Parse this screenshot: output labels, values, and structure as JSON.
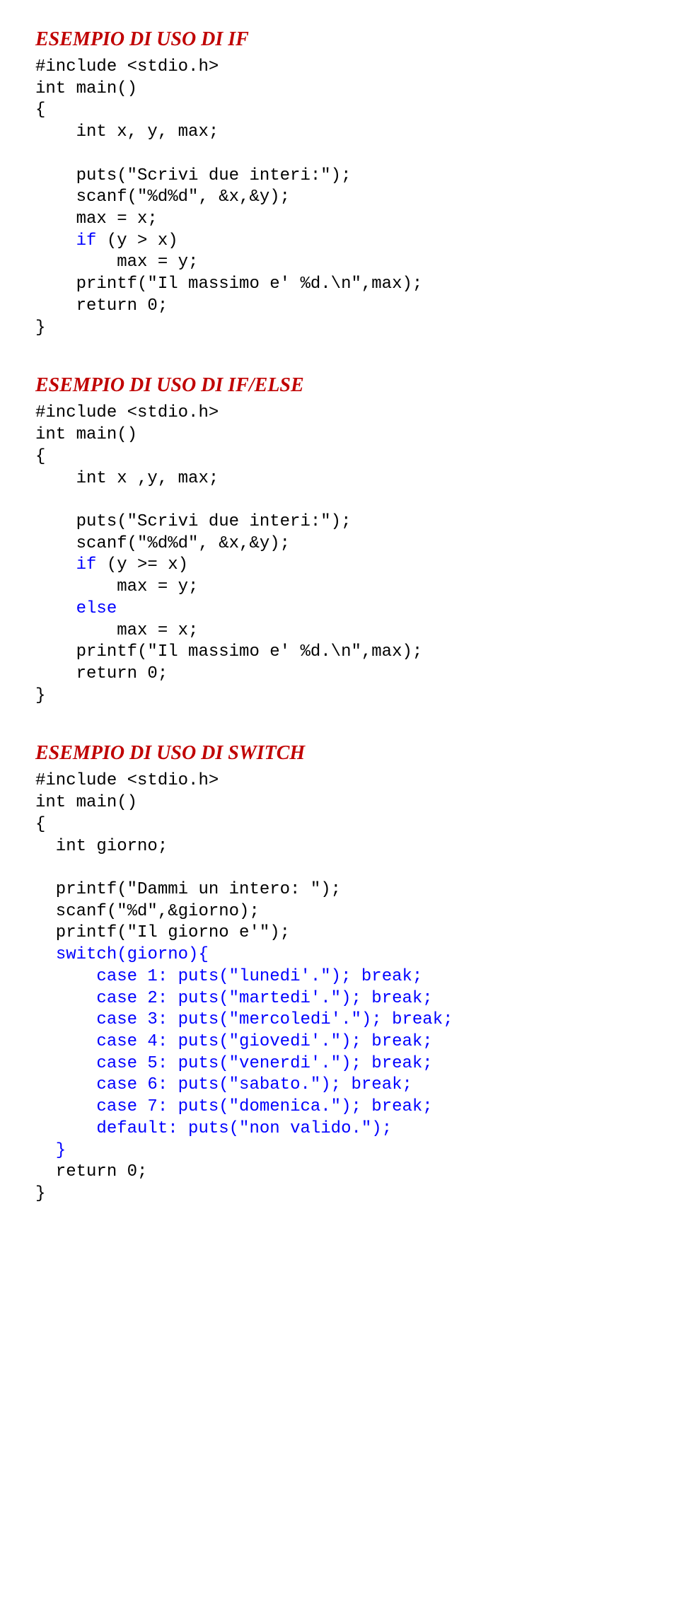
{
  "sections": [
    {
      "heading": "ESEMPIO DI USO DI IF",
      "code": [
        {
          "t": "#include <stdio.h>",
          "c": "blk"
        },
        {
          "t": "int main()",
          "c": "blk"
        },
        {
          "t": "{",
          "c": "blk"
        },
        {
          "t": "    int x, y, max;",
          "c": "blk"
        },
        {
          "t": "",
          "c": "blk"
        },
        {
          "t": "    puts(\"Scrivi due interi:\");",
          "c": "blk"
        },
        {
          "t": "    scanf(\"%d%d\", &x,&y);",
          "c": "blk"
        },
        {
          "t": "    max = x;",
          "c": "blk"
        },
        [
          {
            "t": "    ",
            "c": "blk"
          },
          {
            "t": "if",
            "c": "kw"
          },
          {
            "t": " (y > x)",
            "c": "blk"
          }
        ],
        {
          "t": "        max = y;",
          "c": "blk"
        },
        {
          "t": "    printf(\"Il massimo e' %d.\\n\",max);",
          "c": "blk"
        },
        {
          "t": "    return 0;",
          "c": "blk"
        },
        {
          "t": "}",
          "c": "blk"
        }
      ]
    },
    {
      "heading": "ESEMPIO DI USO DI IF/ELSE",
      "code": [
        {
          "t": "#include <stdio.h>",
          "c": "blk"
        },
        {
          "t": "int main()",
          "c": "blk"
        },
        {
          "t": "{",
          "c": "blk"
        },
        {
          "t": "    int x ,y, max;",
          "c": "blk"
        },
        {
          "t": "",
          "c": "blk"
        },
        {
          "t": "    puts(\"Scrivi due interi:\");",
          "c": "blk"
        },
        {
          "t": "    scanf(\"%d%d\", &x,&y);",
          "c": "blk"
        },
        [
          {
            "t": "    ",
            "c": "blk"
          },
          {
            "t": "if",
            "c": "kw"
          },
          {
            "t": " (y >= x)",
            "c": "blk"
          }
        ],
        {
          "t": "        max = y;",
          "c": "blk"
        },
        [
          {
            "t": "    ",
            "c": "blk"
          },
          {
            "t": "else",
            "c": "kw"
          }
        ],
        {
          "t": "        max = x;",
          "c": "blk"
        },
        {
          "t": "    printf(\"Il massimo e' %d.\\n\",max);",
          "c": "blk"
        },
        {
          "t": "    return 0;",
          "c": "blk"
        },
        {
          "t": "}",
          "c": "blk"
        }
      ]
    },
    {
      "heading": "ESEMPIO DI USO DI SWITCH",
      "code": [
        {
          "t": "#include <stdio.h>",
          "c": "blk"
        },
        {
          "t": "int main()",
          "c": "blk"
        },
        {
          "t": "{",
          "c": "blk"
        },
        {
          "t": "  int giorno;",
          "c": "blk"
        },
        {
          "t": "",
          "c": "blk"
        },
        {
          "t": "  printf(\"Dammi un intero: \");",
          "c": "blk"
        },
        {
          "t": "  scanf(\"%d\",&giorno);",
          "c": "blk"
        },
        {
          "t": "  printf(\"Il giorno e'\");",
          "c": "blk"
        },
        [
          {
            "t": "  ",
            "c": "blk"
          },
          {
            "t": "switch",
            "c": "kw"
          },
          {
            "t": "(giorno){",
            "c": "kw"
          }
        ],
        [
          {
            "t": "      ",
            "c": "blk"
          },
          {
            "t": "case 1: ",
            "c": "kw"
          },
          {
            "t": "puts(\"lunedi'.\"); break;",
            "c": "kw"
          }
        ],
        [
          {
            "t": "      ",
            "c": "blk"
          },
          {
            "t": "case 2: ",
            "c": "kw"
          },
          {
            "t": "puts(\"martedi'.\"); break;",
            "c": "kw"
          }
        ],
        [
          {
            "t": "      ",
            "c": "blk"
          },
          {
            "t": "case 3: ",
            "c": "kw"
          },
          {
            "t": "puts(\"mercoledi'.\"); break;",
            "c": "kw"
          }
        ],
        [
          {
            "t": "      ",
            "c": "blk"
          },
          {
            "t": "case 4: ",
            "c": "kw"
          },
          {
            "t": "puts(\"giovedi'.\"); break;",
            "c": "kw"
          }
        ],
        [
          {
            "t": "      ",
            "c": "blk"
          },
          {
            "t": "case 5: ",
            "c": "kw"
          },
          {
            "t": "puts(\"venerdi'.\"); break;",
            "c": "kw"
          }
        ],
        [
          {
            "t": "      ",
            "c": "blk"
          },
          {
            "t": "case 6: ",
            "c": "kw"
          },
          {
            "t": "puts(\"sabato.\"); break;",
            "c": "kw"
          }
        ],
        [
          {
            "t": "      ",
            "c": "blk"
          },
          {
            "t": "case 7: ",
            "c": "kw"
          },
          {
            "t": "puts(\"domenica.\"); break;",
            "c": "kw"
          }
        ],
        [
          {
            "t": "      ",
            "c": "blk"
          },
          {
            "t": "default: ",
            "c": "kw"
          },
          {
            "t": "puts(\"non valido.\");",
            "c": "kw"
          }
        ],
        {
          "t": "  }",
          "c": "kw"
        },
        {
          "t": "  return 0;",
          "c": "blk"
        },
        {
          "t": "}",
          "c": "blk"
        }
      ]
    }
  ]
}
